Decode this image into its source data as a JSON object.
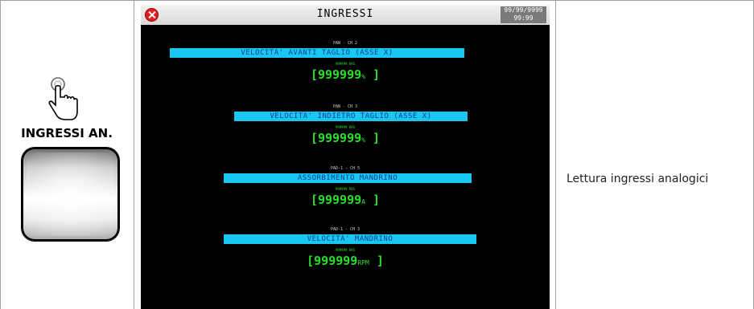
{
  "left_cell": {
    "button_label": "INGRESSI AN."
  },
  "screen": {
    "title": "INGRESSI",
    "date": "99/99/9999",
    "time": "99:99",
    "items": [
      {
        "tag": "PAN - CH 2",
        "label": "VELOCITA' AVANTI TAGLIO (ASSE X)",
        "unit_tag": "999999 RAS",
        "value": "[999999",
        "unit": "%",
        "close": "]"
      },
      {
        "tag": "PAN - CH 3",
        "label": "VELOCITA' INDIETRO TAGLIO (ASSE X)",
        "unit_tag": "999999 RAS",
        "value": "[999999",
        "unit": "%",
        "close": "]"
      },
      {
        "tag": "PAD-1 - CH 5",
        "label": "ASSORBIMENTO MANDRINO",
        "unit_tag": "999999 RAS",
        "value": "[999999",
        "unit": "A",
        "close": "]"
      },
      {
        "tag": "PAD-1 - CH 3",
        "label": "VELOCITA' MANDRINO",
        "unit_tag": "999999 RAS",
        "value": "[999999",
        "unit": "RPM",
        "close": "]"
      }
    ]
  },
  "description": "Lettura ingressi analogici",
  "colors": {
    "bar": "#19c8f0",
    "value_text": "#28e028",
    "screen_bg": "#000000"
  }
}
